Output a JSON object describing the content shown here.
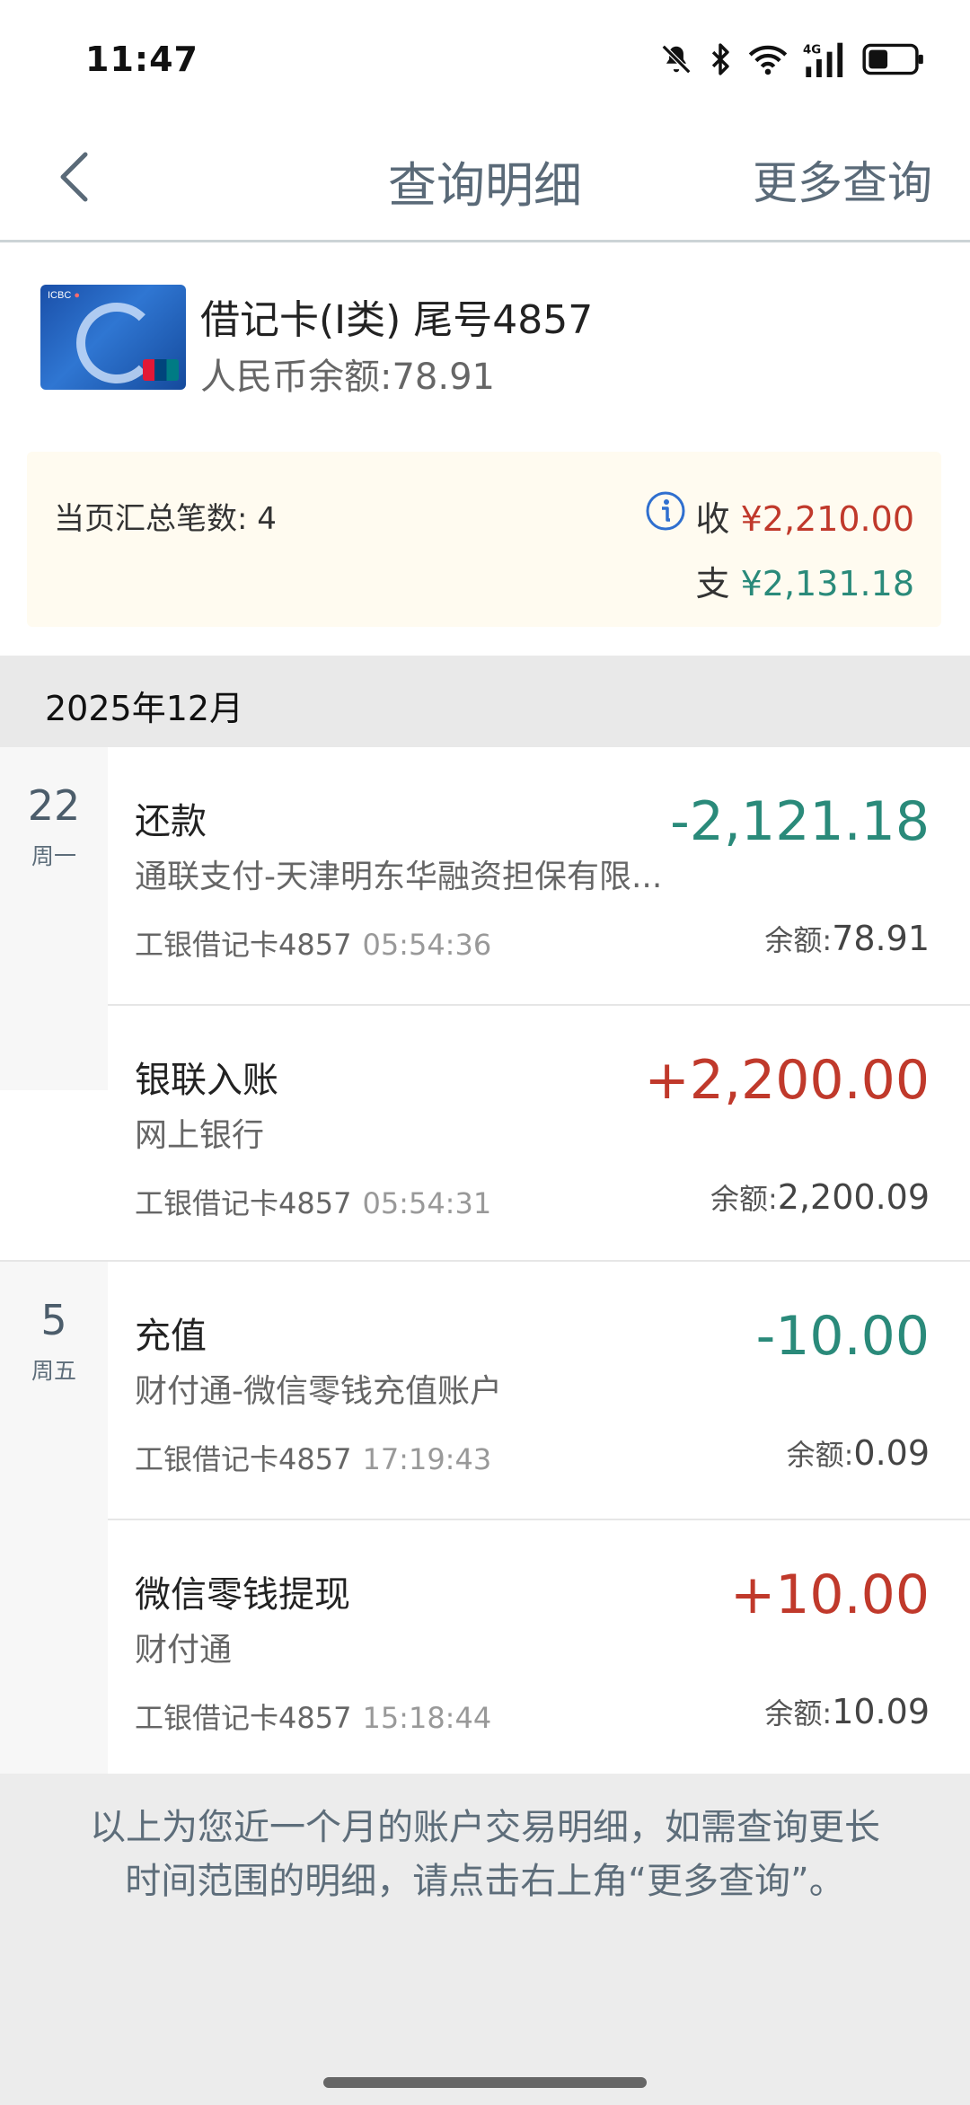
{
  "status_bar": {
    "time": "11:47",
    "icons": [
      "mute-icon",
      "bluetooth-icon",
      "wifi-icon",
      "4g-signal-icon",
      "battery-icon"
    ],
    "network": "4G"
  },
  "nav": {
    "title": "查询明细",
    "more": "更多查询",
    "back_icon": "chevron-left-icon"
  },
  "account": {
    "name": "借记卡(I类) 尾号4857",
    "balance": "人民币余额:78.91"
  },
  "summary": {
    "count_label": "当页汇总笔数: 4",
    "in_label": "收",
    "in_amount": "¥2,210.00",
    "out_label": "支",
    "out_amount": "¥2,131.18"
  },
  "month": "2025年12月",
  "groups": [
    {
      "day": "22",
      "weekday": "周一",
      "transactions": [
        {
          "title": "还款",
          "description": "通联支付-天津明东华融资担保有限...",
          "card": "工银借记卡4857",
          "time": "05:54:36",
          "amount": "-2,121.18",
          "balance_label": "余额:",
          "balance": "78.91"
        },
        {
          "title": "银联入账",
          "description": "网上银行",
          "card": "工银借记卡4857",
          "time": "05:54:31",
          "amount": "+2,200.00",
          "balance_label": "余额:",
          "balance": "2,200.09"
        }
      ]
    },
    {
      "day": "5",
      "weekday": "周五",
      "transactions": [
        {
          "title": "充值",
          "description": "财付通-微信零钱充值账户",
          "card": "工银借记卡4857",
          "time": "17:19:43",
          "amount": "-10.00",
          "balance_label": "余额:",
          "balance": "0.09"
        },
        {
          "title": "微信零钱提现",
          "description": "财付通",
          "card": "工银借记卡4857",
          "time": "15:18:44",
          "amount": "+10.00",
          "balance_label": "余额:",
          "balance": "10.09"
        }
      ]
    }
  ],
  "footer": {
    "line1": "以上为您近一个月的账户交易明细，如需查询更长",
    "line2": "时间范围的明细，请点击右上角“更多查询”。"
  },
  "colors": {
    "income": "#c0392b",
    "expense": "#2a8a7a",
    "nav_text": "#5a6a78",
    "summary_bg": "#fffbf0"
  }
}
